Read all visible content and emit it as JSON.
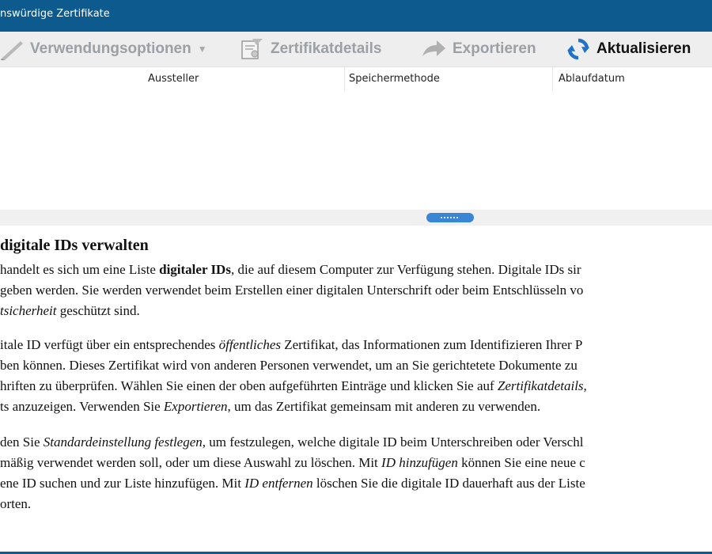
{
  "window": {
    "title": "nswürdige Zertifikate"
  },
  "toolbar": {
    "usage_options": "Verwendungsoptionen",
    "certificate_details": "Zertifikatdetails",
    "export": "Exportieren",
    "refresh": "Aktualisieren"
  },
  "columns": [
    "Aussteller",
    "Speichermethode",
    "Ablaufdatum"
  ],
  "help": {
    "title": "digitale IDs verwalten",
    "paragraph1": [
      [
        {
          "t": "handelt es sich um eine Liste "
        },
        {
          "t": "digitaler IDs",
          "s": "b"
        },
        {
          "t": ", die auf diesem Computer zur Verfügung stehen. Digitale IDs sir"
        }
      ],
      [
        {
          "t": "geben werden. Sie werden verwendet beim Erstellen einer digitalen Unterschrift oder beim Entschlüsseln vo"
        }
      ],
      [
        {
          "t": "tsicherheit",
          "s": "i"
        },
        {
          "t": " geschützt sind."
        }
      ]
    ],
    "paragraph2": [
      [
        {
          "t": "itale ID verfügt über ein entsprechendes "
        },
        {
          "t": "öffentliches",
          "s": "i"
        },
        {
          "t": " Zertifikat, das Informationen zum Identifizieren Ihrer P"
        }
      ],
      [
        {
          "t": "ben können. Dieses Zertifikat wird von anderen Personen verwendet, um an Sie gerichtetete Dokumente zu"
        }
      ],
      [
        {
          "t": "hriften zu überprüfen. Wählen Sie einen der oben aufgeführten Einträge und klicken Sie auf "
        },
        {
          "t": "Zertifikatdetails,",
          "s": "i"
        }
      ],
      [
        {
          "t": "ts anzuzeigen. Verwenden Sie "
        },
        {
          "t": "Exportieren",
          "s": "i"
        },
        {
          "t": ", um das Zertifikat gemeinsam mit anderen zu verwenden."
        }
      ]
    ],
    "paragraph3": [
      [
        {
          "t": "den Sie "
        },
        {
          "t": "Standardeinstellung festlegen",
          "s": "i"
        },
        {
          "t": ", um festzulegen, welche digitale ID beim Unterschreiben oder Verschl"
        }
      ],
      [
        {
          "t": "mäßig verwendet werden soll, oder um diese Auswahl zu löschen. Mit "
        },
        {
          "t": "ID hinzufügen",
          "s": "i"
        },
        {
          "t": " können Sie eine neue c"
        }
      ],
      [
        {
          "t": "ene ID suchen und zur Liste hinzufügen. Mit "
        },
        {
          "t": "ID entfernen",
          "s": "i"
        },
        {
          "t": " löschen Sie die digitale ID dauerhaft aus der Liste"
        }
      ],
      [
        {
          "t": "orten."
        }
      ]
    ]
  },
  "colors": {
    "titlebar": "#0d5a8f",
    "toolbar_bg": "#eeeeee",
    "disabled_text": "#9aa0a6",
    "refresh_icon": "#1f72c7",
    "splitter_grip": "#3a86d6"
  },
  "icons": {
    "usage_options": "pen-icon",
    "certificate_details": "certificate-icon",
    "export": "export-arrow-icon",
    "refresh": "refresh-icon"
  }
}
